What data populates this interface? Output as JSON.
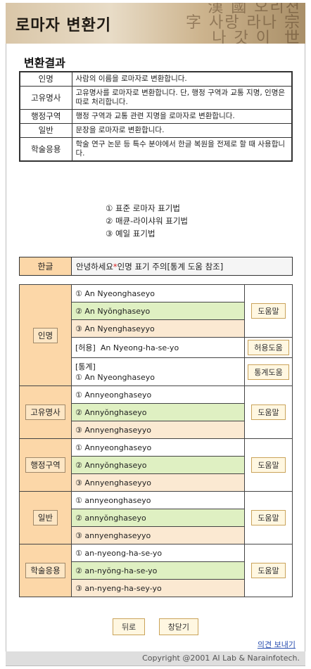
{
  "header": {
    "title": "로마자 변환기",
    "decoration_text": "漢 國 오리젼\n字 사랑 라나 宗\n 나 갓 이  世"
  },
  "section_title": "변환결과",
  "description_rows": [
    {
      "key": "인명",
      "text": "사람의 이름을 로마자로 변환합니다."
    },
    {
      "key": "고유명사",
      "text": "고유명사를 로마자로 변환합니다. 단, 행정 구역과 교통 지명, 인명은 따로 처리합니다."
    },
    {
      "key": "행정구역",
      "text": "행정 구역과 교통 관련 지명을 로마자로 변환합니다."
    },
    {
      "key": "일반",
      "text": "문장을 로마자로 변환합니다."
    },
    {
      "key": "학술응용",
      "text": "학술 연구 논문 등 특수 분야에서 한글 복원을 전제로 할 때 사용합니다."
    }
  ],
  "legend": [
    "① 표준 로마자 표기법",
    "② 매큔-라이샤워 표기법",
    "③ 예일 표기법"
  ],
  "input": {
    "label": "한글",
    "value_before": "안녕하세요 ",
    "value_star": "*",
    "value_after": "인명 표기 주의[통계 도움 참조]"
  },
  "results": {
    "name": {
      "label": "인명",
      "r1": "① An Nyeonghaseyo",
      "r2": "② An Nyŏnghaseyo",
      "r3": "③ An Nyenghaseyyo",
      "help": "도움말",
      "allow_label": "[허용]",
      "allow_value": "An Nyeong-ha-se-yo",
      "allow_button": "허용도움",
      "stats_label": "[통계]",
      "stats_value": "① An Nyeonghaseyo",
      "stats_button": "통계도움"
    },
    "proper": {
      "label": "고유명사",
      "r1": "① Annyeonghaseyo",
      "r2": "② Annyŏnghaseyo",
      "r3": "③ Annyenghaseyyo",
      "help": "도움말"
    },
    "admin": {
      "label": "행정구역",
      "r1": "① Annyeonghaseyo",
      "r2": "② Annyŏnghaseyo",
      "r3": "③ Annyenghaseyyo",
      "help": "도움말"
    },
    "general": {
      "label": "일반",
      "r1": "① annyeonghaseyo",
      "r2": "② annyŏnghaseyo",
      "r3": "③ annyenghaseyyo",
      "help": "도움말"
    },
    "academic": {
      "label": "학술응용",
      "r1": "① an-nyeong-ha-se-yo",
      "r2": "② an-nyŏng-ha-se-yo",
      "r3": "③ an-nyeng-ha-sey-yo",
      "help": "도움말"
    }
  },
  "buttons": {
    "back": "뒤로",
    "close": "창닫기"
  },
  "feedback_link": "의견 보내기",
  "copyright": "Copyright @2001 AI Lab & Narainfotech."
}
